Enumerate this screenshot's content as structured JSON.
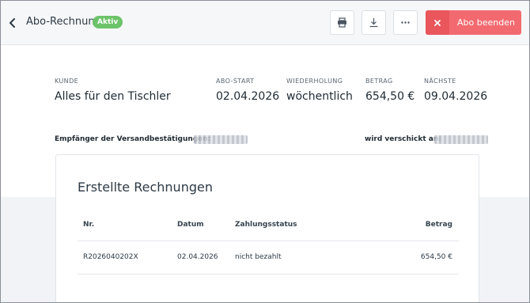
{
  "header": {
    "title": "Abo-Rechnung",
    "status_badge": "Aktiv",
    "end_button_label": "Abo beenden",
    "icons": [
      "chevron-left-icon",
      "printer-icon",
      "download-icon",
      "more-horizontal-icon",
      "close-icon"
    ]
  },
  "summary": {
    "customer_label": "KUNDE",
    "customer_value": "Alles für den Tischler",
    "start_label": "ABO-START",
    "start_value": "02.04.2026",
    "repeat_label": "WIEDERHOLUNG",
    "repeat_value": "wöchentlich",
    "amount_label": "BETRAG",
    "amount_value": "654,50 €",
    "next_label": "NÄCHSTE",
    "next_value": "09.04.2026"
  },
  "shipping": {
    "recipients_label": "Empfänger der Versandbestätigungen:",
    "sent_to_label": "wird verschickt an:"
  },
  "invoices": {
    "title": "Erstellte Rechnungen",
    "columns": {
      "nr": "Nr.",
      "date": "Datum",
      "status": "Zahlungsstatus",
      "amount": "Betrag"
    },
    "rows": [
      {
        "nr": "R2026040202X",
        "date": "02.04.2026",
        "status": "nicht bezahlt",
        "amount": "654,50 €"
      }
    ]
  },
  "colors": {
    "badge": "#6cc36a",
    "danger": "#f26a6f",
    "danger_dark": "#e9565c",
    "header_bg": "#f6f7f9"
  }
}
